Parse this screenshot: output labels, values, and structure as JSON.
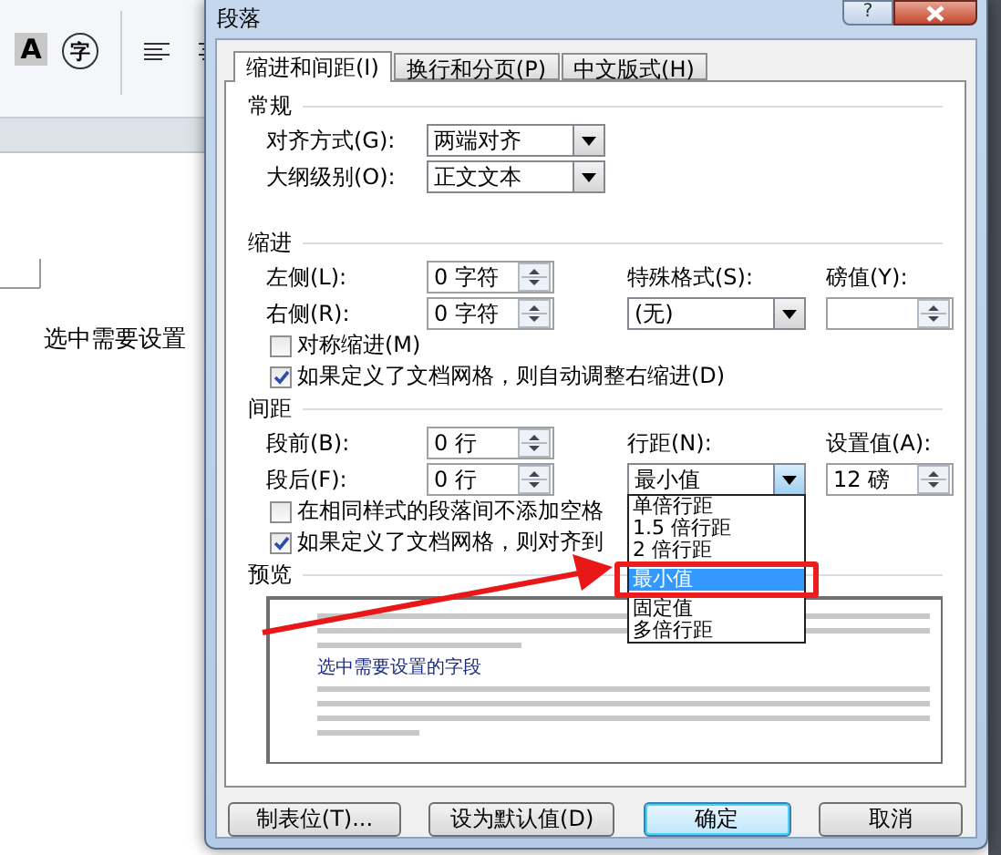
{
  "ribbon": {
    "buttons": [
      {
        "label": "A"
      },
      {
        "label": "字"
      }
    ]
  },
  "document": {
    "text": "选中需要设置"
  },
  "window": {
    "title": "段落",
    "help_button": "?"
  },
  "tabs": [
    {
      "label": "缩进和间距(I)",
      "selected": true
    },
    {
      "label": "换行和分页(P)",
      "selected": false
    },
    {
      "label": "中文版式(H)",
      "selected": false
    }
  ],
  "sections": [
    {
      "title": "常规",
      "items": [
        {
          "kind": "fields",
          "cells": [
            {
              "kind": "label",
              "text": "对齐方式(G):"
            },
            {
              "kind": "select",
              "value": "两端对齐"
            }
          ]
        },
        {
          "kind": "fields",
          "cells": [
            {
              "kind": "label",
              "text": "大纲级别(O):"
            },
            {
              "kind": "select",
              "value": "正文文本"
            }
          ]
        }
      ]
    },
    {
      "title": "缩进",
      "items": [
        {
          "kind": "fields",
          "cells": [
            {
              "kind": "label",
              "text": "左侧(L):"
            },
            {
              "kind": "spin",
              "value": "0 字符"
            },
            {
              "kind": "label",
              "text": "特殊格式(S):"
            },
            {
              "kind": "label",
              "text": "磅值(Y):"
            }
          ]
        },
        {
          "kind": "fields",
          "cells": [
            {
              "kind": "label",
              "text": "右侧(R):"
            },
            {
              "kind": "spin",
              "value": "0 字符"
            },
            {
              "kind": "select",
              "value": "(无)"
            },
            {
              "kind": "spin"
            }
          ]
        },
        {
          "kind": "checkbox",
          "label": "对称缩进(M)",
          "checked": false
        },
        {
          "kind": "checkbox",
          "label": "如果定义了文档网格，则自动调整右缩进(D)",
          "checked": true
        }
      ]
    },
    {
      "title": "间距",
      "items": [
        {
          "kind": "fields",
          "cells": [
            {
              "kind": "label",
              "text": "段前(B):"
            },
            {
              "kind": "spin",
              "value": "0 行"
            },
            {
              "kind": "label",
              "text": "行距(N):"
            },
            {
              "kind": "label",
              "text": "设置值(A):"
            }
          ]
        },
        {
          "kind": "fields",
          "cells": [
            {
              "kind": "label",
              "text": "段后(F):"
            },
            {
              "kind": "spin",
              "value": "0 行"
            },
            {
              "kind": "select",
              "value": "最小值",
              "open": true,
              "options": [
                {
                  "label": "单倍行距",
                  "selected": false
                },
                {
                  "label": "1.5 倍行距",
                  "selected": false
                },
                {
                  "label": "2 倍行距",
                  "selected": false
                },
                {
                  "label": "最小值",
                  "selected": true
                },
                {
                  "label": "固定值",
                  "selected": false
                },
                {
                  "label": "多倍行距",
                  "selected": false
                }
              ]
            },
            {
              "kind": "spin",
              "value": "12 磅"
            }
          ]
        },
        {
          "kind": "checkbox",
          "label": "在相同样式的段落间不添加空格",
          "checked": false
        },
        {
          "kind": "checkbox",
          "label": "如果定义了文档网格，则对齐到",
          "checked": true
        }
      ]
    }
  ],
  "preview": {
    "title": "预览",
    "sample_text": "选中需要设置的字段"
  },
  "buttons": [
    {
      "label": "制表位(T)...",
      "default": false
    },
    {
      "label": "设为默认值(D)",
      "default": false
    },
    {
      "label": "确定",
      "default": true
    },
    {
      "label": "取消",
      "default": false
    }
  ]
}
